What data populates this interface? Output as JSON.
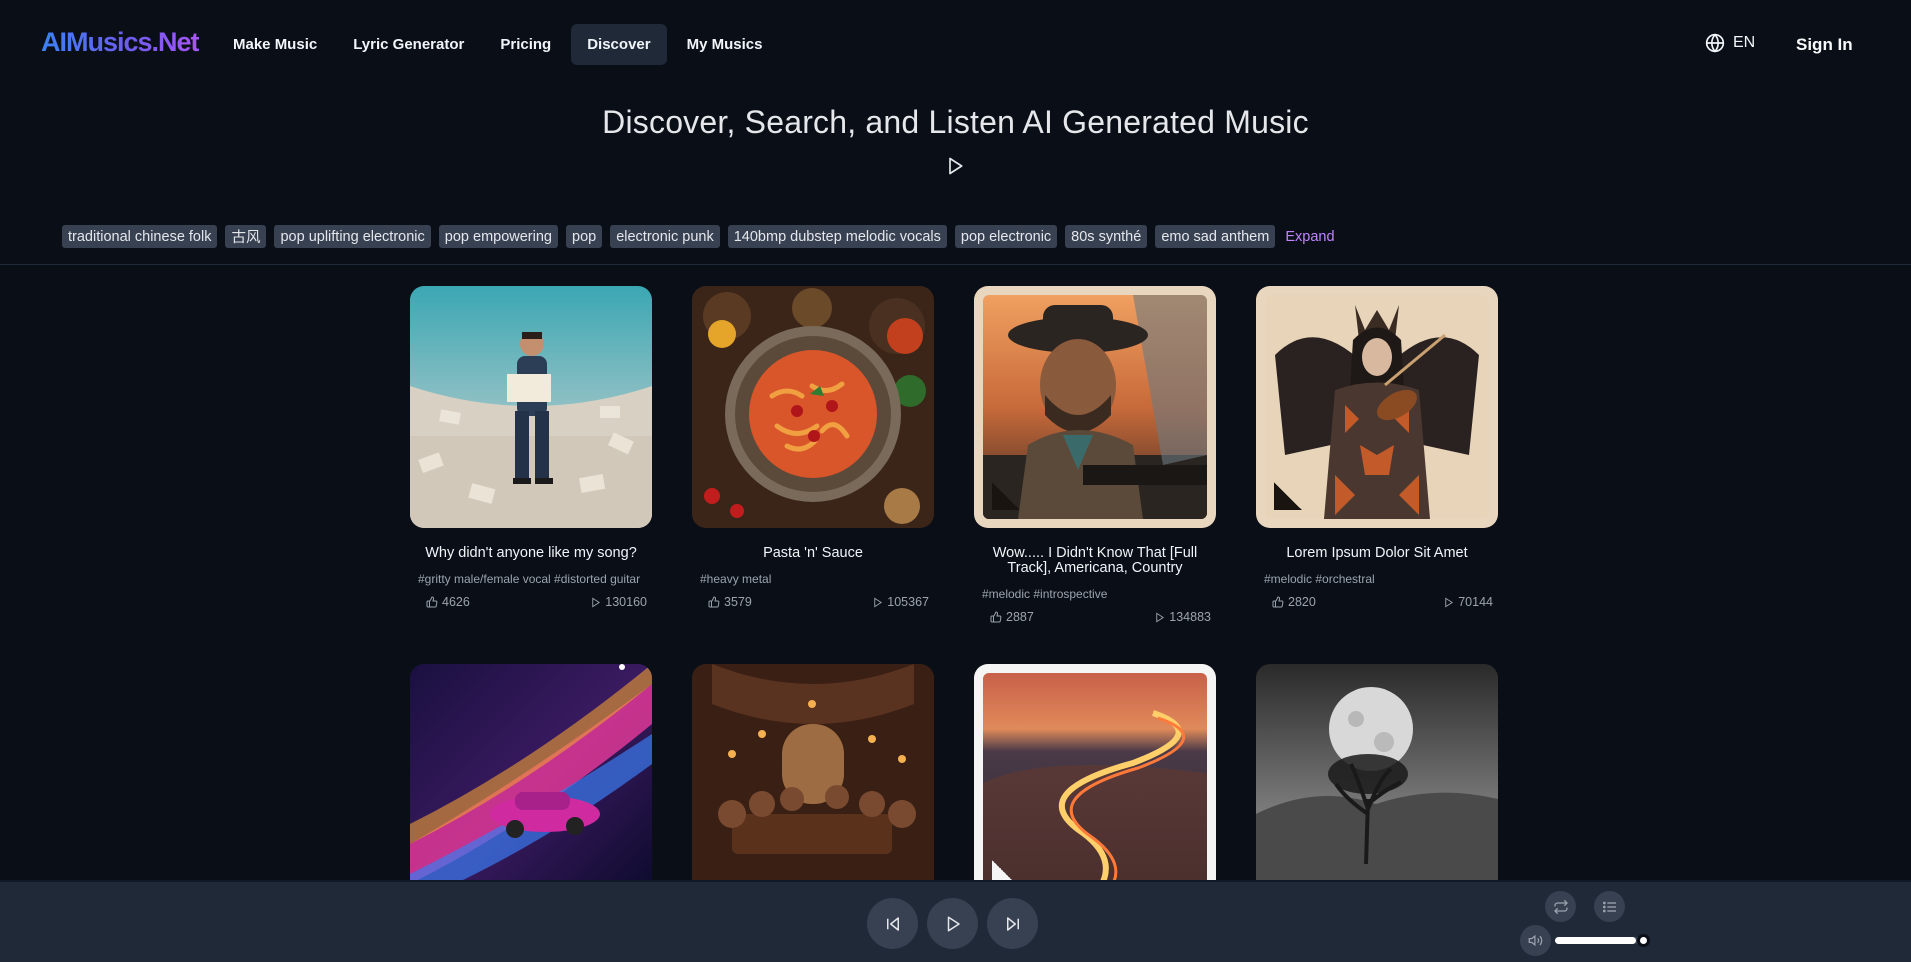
{
  "header": {
    "logo": "AIMusics.Net",
    "nav": [
      "Make Music",
      "Lyric Generator",
      "Pricing",
      "Discover",
      "My Musics"
    ],
    "active_nav": "Discover",
    "language": "EN",
    "sign_in": "Sign In"
  },
  "hero": {
    "title": "Discover, Search, and Listen AI Generated Music"
  },
  "tags": [
    "traditional chinese folk",
    "古风",
    "pop uplifting electronic",
    "pop empowering",
    "pop",
    "electronic punk",
    "140bmp dubstep melodic vocals",
    "pop electronic",
    "80s synthé",
    "emo sad anthem"
  ],
  "expand_label": "Expand",
  "songs": [
    {
      "title": "Why didn't anyone like my song?",
      "tags": "#gritty male/female vocal #distorted guitar",
      "likes": "4626",
      "plays": "130160"
    },
    {
      "title": "Pasta 'n' Sauce",
      "tags": "#heavy metal",
      "likes": "3579",
      "plays": "105367"
    },
    {
      "title": "Wow..... I Didn't Know That [Full Track], Americana, Country",
      "tags": "#melodic #introspective",
      "likes": "2887",
      "plays": "134883"
    },
    {
      "title": "Lorem Ipsum Dolor Sit Amet",
      "tags": "#melodic #orchestral",
      "likes": "2820",
      "plays": "70144"
    }
  ],
  "player": {
    "volume": 0.9
  },
  "colors": {
    "background": "#0a0f17",
    "accent_purple": "#c084fc",
    "logo_blue": "#3b82f6",
    "logo_purple": "#a855f7",
    "player_bar": "#1f2937"
  },
  "icons": [
    "globe-icon",
    "play-icon",
    "thumbs-up-icon",
    "skip-back-icon",
    "skip-forward-icon",
    "repeat-icon",
    "playlist-icon",
    "volume-icon"
  ]
}
